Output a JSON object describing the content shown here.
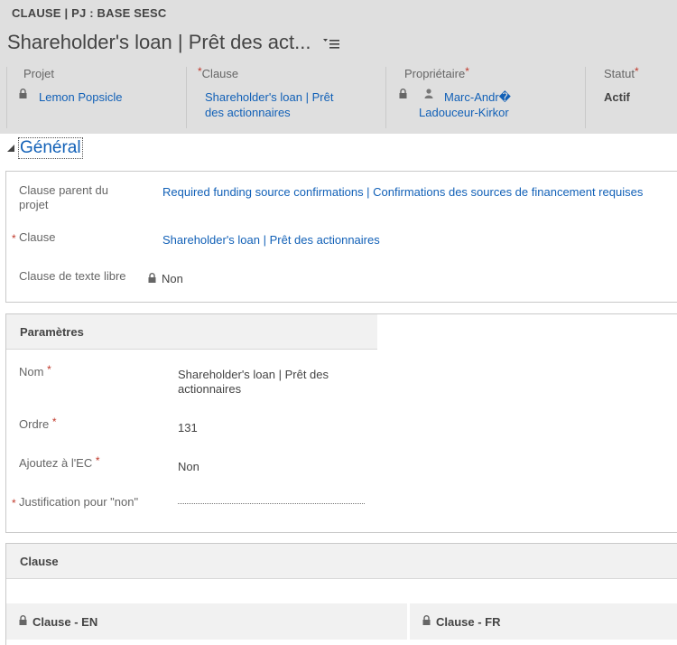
{
  "header": {
    "entity_type": "CLAUSE | PJ : BASE SESC",
    "record_title": "Shareholder's loan | Prêt des act...",
    "menu_icon": "list-menu-icon",
    "fields": {
      "projet": {
        "label": "Projet",
        "value": "Lemon Popsicle"
      },
      "clause": {
        "label": "Clause",
        "value_line1": "Shareholder's loan | Prêt",
        "value_line2": "des actionnaires"
      },
      "proprietaire": {
        "label": "Propriétaire",
        "value_line1": "Marc-Andr�",
        "value_line2": "Ladouceur-Kirkor"
      },
      "statut": {
        "label": "Statut",
        "value": "Actif"
      }
    },
    "required_mark": "*"
  },
  "general": {
    "title": "Général",
    "clause_parent": {
      "label_line1": "Clause parent du",
      "label_line2": "projet",
      "value": "Required funding source confirmations | Confirmations des sources de financement requises"
    },
    "clause": {
      "label": "Clause",
      "value": "Shareholder's loan | Prêt des actionnaires"
    },
    "texte_libre": {
      "label": "Clause de texte libre",
      "value": "Non"
    }
  },
  "parametres": {
    "title": "Paramètres",
    "nom": {
      "label": "Nom",
      "value_line1": "Shareholder's loan | Prêt des",
      "value_line2": "actionnaires"
    },
    "ordre": {
      "label": "Ordre",
      "value": "131"
    },
    "ajoutez": {
      "label": "Ajoutez à l'EC",
      "value": "Non"
    },
    "justification": {
      "label": "Justification pour \"non\"",
      "value": ""
    }
  },
  "clause_section": {
    "title": "Clause",
    "col_en": "Clause - EN",
    "col_fr": "Clause - FR"
  },
  "colors": {
    "header_bg": "#dfdfdf",
    "link": "#1160b7",
    "required": "#c0392b"
  }
}
